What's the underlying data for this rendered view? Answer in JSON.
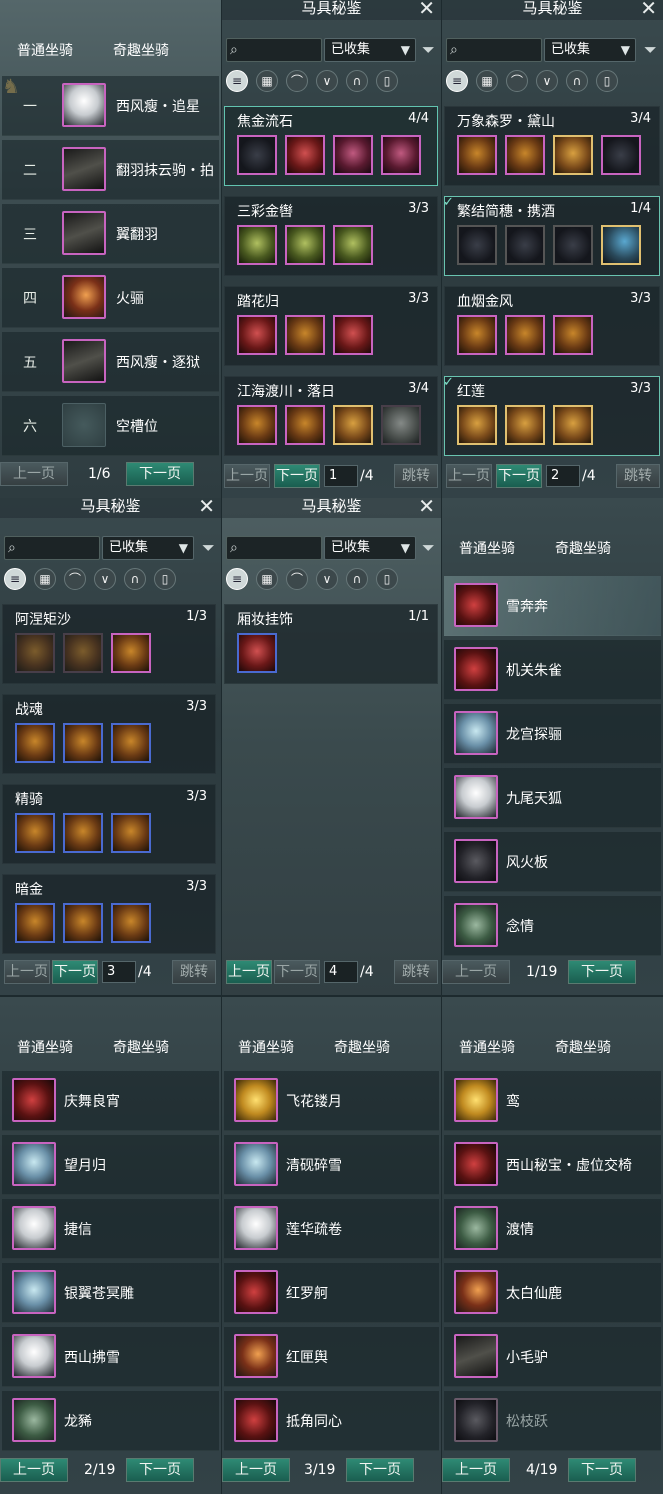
{
  "colors": {
    "accent": "#1f6e5c",
    "rare_border": "#c864c0",
    "epic_border": "#4a6ad0",
    "legend_border": "#e0c070"
  },
  "mount_tabs": {
    "normal": "普通坐骑",
    "fun": "奇趣坐骑"
  },
  "pager_labels": {
    "prev": "上一页",
    "next": "下一页",
    "jump": "跳转"
  },
  "codex": {
    "title": "马具秘鉴",
    "filter_value": "已收集",
    "close_icon": "✕",
    "search_icon": "⌕",
    "filter_icon": "⏷"
  },
  "normal_mounts": {
    "page": "1/6",
    "rows": [
      {
        "num": "一",
        "name": "西风瘦・追星"
      },
      {
        "num": "二",
        "name": "翻羽抹云驹・拍"
      },
      {
        "num": "三",
        "name": "翼翻羽"
      },
      {
        "num": "四",
        "name": "火骊"
      },
      {
        "num": "五",
        "name": "西风瘦・逐狱"
      },
      {
        "num": "六",
        "name": "空槽位"
      }
    ]
  },
  "codex_page1": {
    "page_value": "1",
    "page_total": "/4",
    "sets": [
      {
        "name": "焦金流石",
        "count": "4/4"
      },
      {
        "name": "三彩金辔",
        "count": "3/3"
      },
      {
        "name": "踏花归",
        "count": "3/3"
      },
      {
        "name": "江海渡川・落日",
        "count": "3/4"
      }
    ]
  },
  "codex_page2": {
    "page_value": "2",
    "page_total": "/4",
    "sets": [
      {
        "name": "万象森罗・黛山",
        "count": "3/4"
      },
      {
        "name": "繁结简穗・携酒",
        "count": "1/4"
      },
      {
        "name": "血烟金风",
        "count": "3/3"
      },
      {
        "name": "红莲",
        "count": "3/3"
      }
    ]
  },
  "codex_page3": {
    "page_value": "3",
    "page_total": "/4",
    "sets": [
      {
        "name": "阿涅矩沙",
        "count": "1/3"
      },
      {
        "name": "战魂",
        "count": "3/3"
      },
      {
        "name": "精骑",
        "count": "3/3"
      },
      {
        "name": "暗金",
        "count": "3/3"
      }
    ]
  },
  "codex_page4": {
    "page_value": "4",
    "page_total": "/4",
    "sets": [
      {
        "name": "厢妆挂饰",
        "count": "1/1"
      }
    ]
  },
  "fun_page1": {
    "page": "1/19",
    "mounts": [
      "雪奔奔",
      "机关朱雀",
      "龙宫探骊",
      "九尾天狐",
      "风火板",
      "念情"
    ]
  },
  "fun_page2": {
    "page": "2/19",
    "mounts": [
      "庆舞良宵",
      "望月归",
      "捷信",
      "银翼苍冥雕",
      "西山拂雪",
      "龙豨"
    ]
  },
  "fun_page3": {
    "page": "3/19",
    "mounts": [
      "飞花镂月",
      "清砚碎雪",
      "莲华疏卷",
      "红罗舸",
      "红匣舆",
      "抵角同心"
    ]
  },
  "fun_page4": {
    "page": "4/19",
    "mounts": [
      "鸾",
      "西山秘宝・虚位交椅",
      "渡情",
      "太白仙鹿",
      "小毛驴",
      "松枝跃"
    ]
  }
}
